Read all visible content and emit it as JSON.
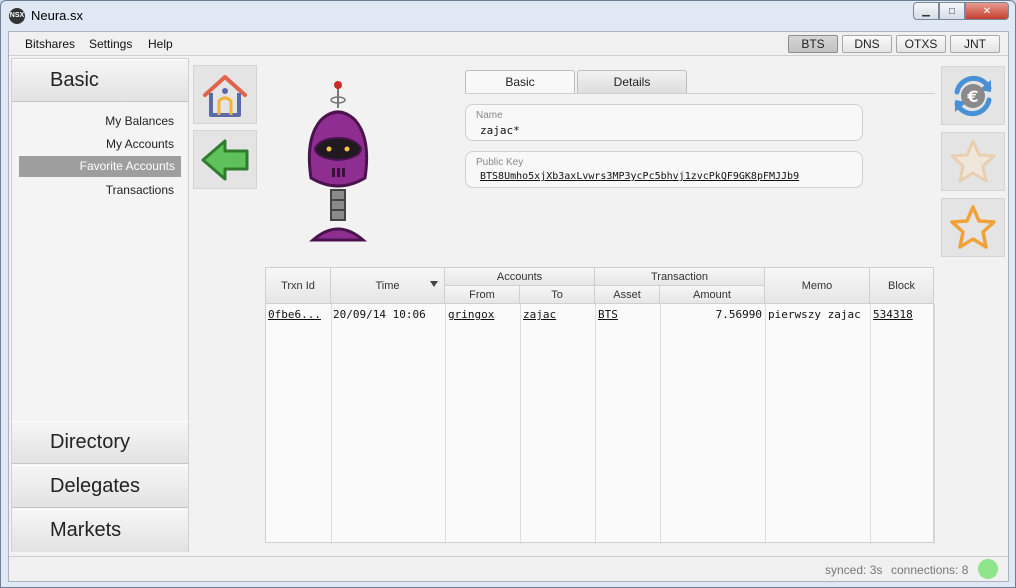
{
  "window": {
    "title": "Neura.sx",
    "app_icon_text": "NSX",
    "minimize": "▁",
    "maximize": "□",
    "close": "✕"
  },
  "menu": {
    "items": [
      "Bitshares",
      "Settings",
      "Help"
    ]
  },
  "currency_tabs": [
    {
      "label": "BTS",
      "selected": true
    },
    {
      "label": "DNS",
      "selected": false
    },
    {
      "label": "OTXS",
      "selected": false
    },
    {
      "label": "JNT",
      "selected": false
    }
  ],
  "sidebar": {
    "top_section": "Basic",
    "links": [
      "My Balances",
      "My Accounts",
      "Favorite Accounts",
      "Transactions"
    ],
    "active_link": "Favorite Accounts",
    "bottom_sections": [
      "Directory",
      "Delegates",
      "Markets"
    ]
  },
  "detail_tabs": [
    {
      "label": "Basic",
      "selected": true
    },
    {
      "label": "Details",
      "selected": false
    }
  ],
  "account": {
    "name_label": "Name",
    "name": "zajac*",
    "public_key_label": "Public Key",
    "public_key": "BTS8Umho5xjXb3axLvwrs3MP3ycPc5bhvj1zvcPkQF9GK8pFMJJb9"
  },
  "icons": {
    "left": [
      "home-icon",
      "back-arrow-icon"
    ],
    "right": [
      "currency-exchange-icon",
      "favorite-star-icon",
      "add-favorite-star-icon"
    ],
    "avatar": "robot-avatar"
  },
  "table": {
    "headers": {
      "trxn_id": "Trxn Id",
      "time": "Time",
      "accounts": "Accounts",
      "from": "From",
      "to": "To",
      "transaction": "Transaction",
      "asset": "Asset",
      "amount": "Amount",
      "memo": "Memo",
      "block": "Block"
    },
    "rows": [
      {
        "trxn_id": "0fbe6...",
        "time": "20/09/14 10:06",
        "from": "gringox",
        "to": "zajac",
        "asset": "BTS",
        "amount": "7.56990",
        "memo": "pierwszy zajac",
        "block": "534318"
      }
    ]
  },
  "status": {
    "synced": "synced: 3s",
    "connections": "connections: 8",
    "indicator_color": "#8ee68a"
  }
}
